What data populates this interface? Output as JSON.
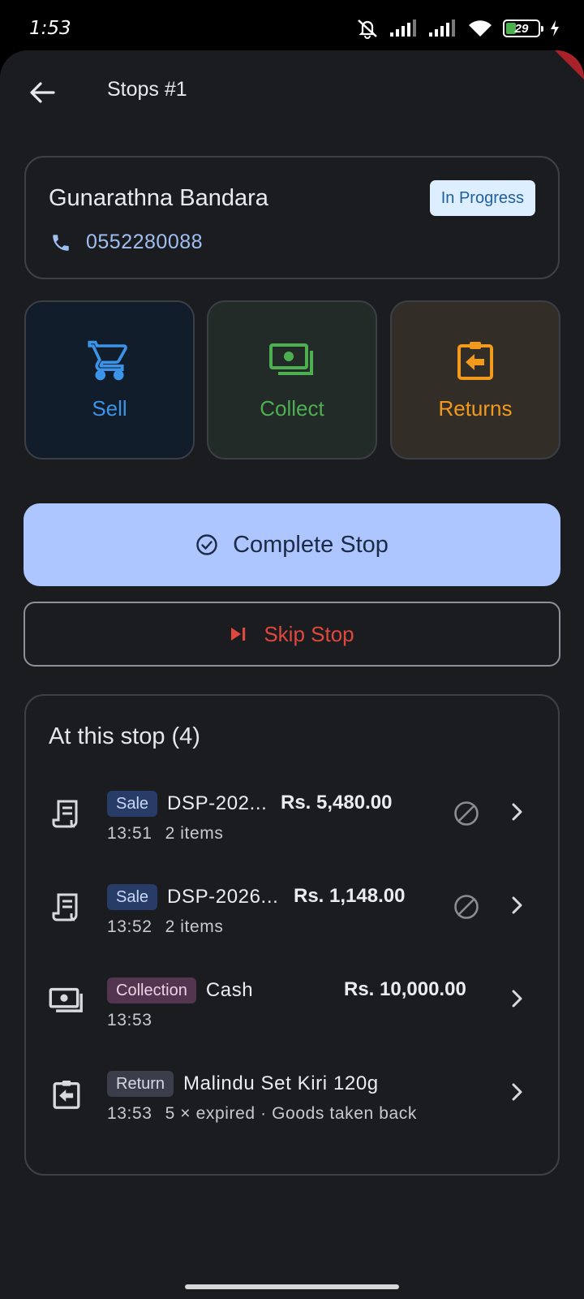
{
  "status_bar": {
    "time": "1:53",
    "battery": "29"
  },
  "header": {
    "title": "Stops #1"
  },
  "customer": {
    "name": "Gunarathna Bandara",
    "status": "In Progress",
    "phone": "0552280088"
  },
  "actions": [
    {
      "label": "Sell",
      "icon": "cart-icon",
      "color": "#3c94e8"
    },
    {
      "label": "Collect",
      "icon": "cash-icon",
      "color": "#4caf50"
    },
    {
      "label": "Returns",
      "icon": "return-clipboard-icon",
      "color": "#f29a1c"
    }
  ],
  "buttons": {
    "complete": "Complete Stop",
    "skip": "Skip Stop"
  },
  "stop_list": {
    "title": "At this stop (4)",
    "entries": [
      {
        "tag": "Sale",
        "ref": "DSP-202...",
        "amount": "Rs. 5,480.00",
        "time": "13:51",
        "detail": "2 items",
        "icon": "receipt-icon"
      },
      {
        "tag": "Sale",
        "ref": "DSP-2026...",
        "amount": "Rs. 1,148.00",
        "time": "13:52",
        "detail": "2 items",
        "icon": "receipt-icon"
      },
      {
        "tag": "Collection",
        "ref": "Cash",
        "amount": "Rs. 10,000.00",
        "time": "13:53",
        "detail": "",
        "icon": "cash-icon"
      },
      {
        "tag": "Return",
        "ref": "Malindu Set Kiri 120g",
        "amount": "",
        "time": "13:53",
        "detail": "5 × expired · Goods taken back",
        "icon": "return-clipboard-icon"
      }
    ]
  }
}
